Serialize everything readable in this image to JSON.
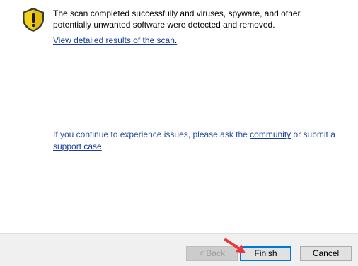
{
  "message": {
    "text": "The scan completed successfully and viruses, spyware, and other potentially unwanted software were detected and removed.",
    "detail_link": "View detailed results of the scan",
    "detail_suffix": "."
  },
  "help": {
    "prefix": "If you continue to experience issues, please ask the ",
    "community_link": "community",
    "middle": " or submit a ",
    "support_link": "support case",
    "suffix": "."
  },
  "buttons": {
    "back": "< Back",
    "finish": "Finish",
    "cancel": "Cancel"
  },
  "icons": {
    "status": "warning-shield-icon",
    "pointer": "red-arrow-icon"
  },
  "colors": {
    "link": "#1a3c9e",
    "shield_yellow": "#f3d21b",
    "arrow_red": "#e8383d",
    "focus_border": "#0078d7"
  }
}
